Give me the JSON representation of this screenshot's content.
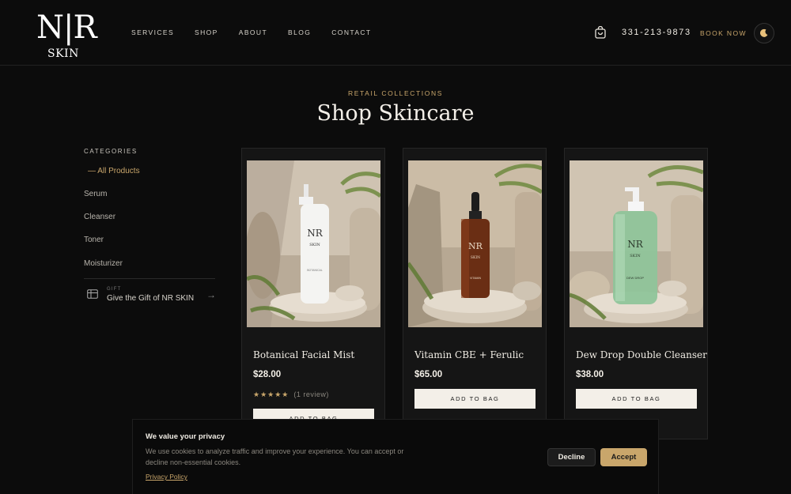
{
  "brand": {
    "logo_main": "N|R",
    "logo_sub": "SKIN"
  },
  "nav": [
    "SERVICES",
    "SHOP",
    "ABOUT",
    "BLOG",
    "CONTACT"
  ],
  "header": {
    "phone": "331-213-9873",
    "book_label": "BOOK NOW"
  },
  "hero": {
    "eyebrow": "RETAIL COLLECTIONS",
    "title": "Shop Skincare"
  },
  "sidebar": {
    "heading": "CATEGORIES",
    "items": [
      {
        "label": "— All Products",
        "active": true
      },
      {
        "label": "Serum",
        "active": false
      },
      {
        "label": "Cleanser",
        "active": false
      },
      {
        "label": "Toner",
        "active": false
      },
      {
        "label": "Moisturizer",
        "active": false
      }
    ],
    "gift": {
      "label": "GIFT",
      "text": "Give the Gift of NR SKIN",
      "arrow": "→"
    }
  },
  "products": [
    {
      "name": "Botanical Facial Mist",
      "price": "$28.00",
      "stars": "★★★★★",
      "reviews": "(1 review)",
      "button": "ADD TO BAG",
      "bottle_label": "BOTANICAL"
    },
    {
      "name": "Vitamin CBE + Ferulic",
      "price": "$65.00",
      "button": "ADD TO BAG",
      "bottle_label": "VITAMIN"
    },
    {
      "name": "Dew Drop Double Cleanser",
      "price": "$38.00",
      "button": "ADD TO BAG",
      "bottle_label": "DEW DROP"
    }
  ],
  "cookie": {
    "title": "We value your privacy",
    "text": "We use cookies to analyze traffic and improve your experience. You can accept or decline non-essential cookies.",
    "link": "Privacy Policy",
    "decline": "Decline",
    "accept": "Accept"
  },
  "colors": {
    "background": "#0c0c0c",
    "accent": "#c9a66b",
    "card": "#151515",
    "button_light": "#f3efe8"
  }
}
